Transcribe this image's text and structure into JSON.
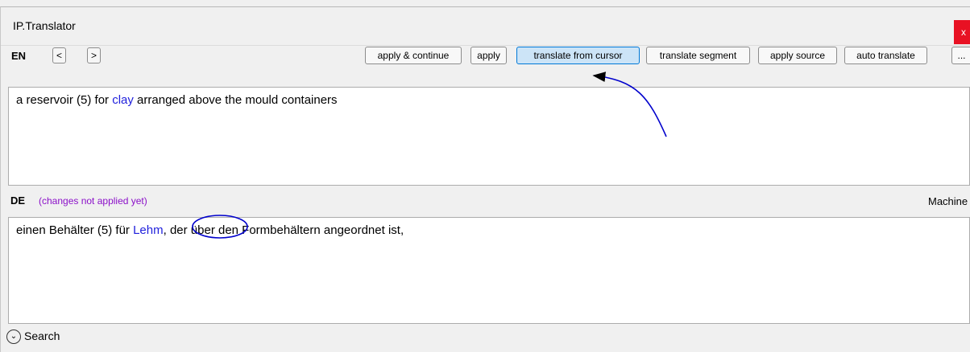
{
  "window": {
    "title": "IP.Translator",
    "close_label": "x"
  },
  "source": {
    "lang": "EN",
    "prev_label": "<",
    "next_label": ">",
    "text_parts": [
      "a reservoir (5) for ",
      "clay",
      " arranged above the mould containers"
    ]
  },
  "toolbar": {
    "apply_continue": "apply & continue",
    "apply": "apply",
    "translate_from_cursor": "translate from cursor",
    "translate_segment": "translate segment",
    "apply_source": "apply source",
    "auto_translate": "auto translate",
    "more": "..."
  },
  "target": {
    "lang": "DE",
    "status": "(changes not applied yet)",
    "mode": "Machine",
    "text_parts": [
      "einen Behälter (5) für ",
      "Lehm",
      ", der über den Formbehältern angeordnet ist,"
    ]
  },
  "search": {
    "label": "Search",
    "chevron": "⌄"
  },
  "colors": {
    "highlight": "#1f1fdc",
    "status": "#8b10c9",
    "annotation": "#0000cc"
  }
}
